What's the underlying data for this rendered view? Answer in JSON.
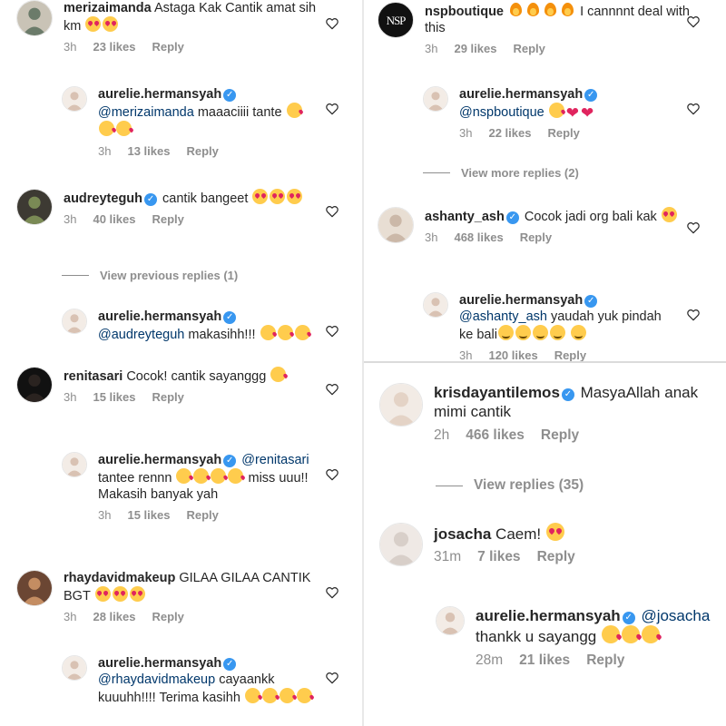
{
  "left": [
    {
      "id": "c1",
      "user": "merizaimanda",
      "verified": false,
      "mention": "",
      "text": "Astaga Kak Cantik amat sih km",
      "emojis": [
        "eyes",
        "eyes"
      ],
      "time": "3h",
      "likes": "23 likes",
      "reply": "Reply"
    },
    {
      "id": "r1",
      "user": "aurelie.hermansyah",
      "verified": true,
      "mention": "@merizaimanda",
      "text": "maaaciiii tante",
      "emojis": [
        "kiss",
        "kiss",
        "kiss"
      ],
      "time": "3h",
      "likes": "13 likes",
      "reply": "Reply"
    },
    {
      "id": "c2",
      "user": "audreyteguh",
      "verified": true,
      "mention": "",
      "text": "cantik bangeet",
      "emojis": [
        "eyes",
        "eyes",
        "eyes"
      ],
      "time": "3h",
      "likes": "40 likes",
      "reply": "Reply"
    },
    {
      "id": "r2",
      "user": "aurelie.hermansyah",
      "verified": true,
      "mention": "@audreyteguh",
      "text": "makasihh!!!",
      "emojis": [
        "kiss",
        "kiss",
        "kiss"
      ],
      "time": "",
      "likes": "",
      "reply": ""
    },
    {
      "id": "c3",
      "user": "renitasari",
      "verified": false,
      "mention": "",
      "text": "Cocok! cantik sayanggg",
      "emojis": [
        "kiss"
      ],
      "time": "3h",
      "likes": "15 likes",
      "reply": "Reply"
    },
    {
      "id": "r3",
      "user": "aurelie.hermansyah",
      "verified": true,
      "mention": "@renitasari",
      "text": "tantee rennn",
      "text2": "miss uuu!! Makasih banyak yah",
      "emojis": [
        "kiss",
        "kiss",
        "kiss",
        "kiss"
      ],
      "time": "3h",
      "likes": "15 likes",
      "reply": "Reply"
    },
    {
      "id": "c4",
      "user": "rhaydavidmakeup",
      "verified": false,
      "mention": "",
      "text": "GILAA GILAA CANTIK BGT",
      "emojis": [
        "eyes",
        "eyes",
        "eyes"
      ],
      "time": "3h",
      "likes": "28 likes",
      "reply": "Reply"
    },
    {
      "id": "r4",
      "user": "aurelie.hermansyah",
      "verified": true,
      "mention": "@rhaydavidmakeup",
      "text": "cayaankk kuuuhh!!!! Terima kasihh",
      "emojis": [
        "kiss",
        "kiss",
        "kiss",
        "kiss"
      ],
      "time": "",
      "likes": "",
      "reply": ""
    }
  ],
  "left_view_previous": "View previous replies (1)",
  "right_top": [
    {
      "id": "c5",
      "user": "nspboutique",
      "verified": false,
      "mention": "",
      "text": "I cannnnt deal with this",
      "emojis_before": [
        "fire",
        "fire",
        "fire",
        "fire"
      ],
      "emojis": [],
      "time": "3h",
      "likes": "29 likes",
      "reply": "Reply"
    },
    {
      "id": "r5",
      "user": "aurelie.hermansyah",
      "verified": true,
      "mention": "@nspboutique",
      "text": "",
      "emojis": [
        "kiss",
        "heart-red",
        "heart-red"
      ],
      "time": "3h",
      "likes": "22 likes",
      "reply": "Reply"
    },
    {
      "id": "c6",
      "user": "ashanty_ash",
      "verified": true,
      "mention": "",
      "text": "Cocok jadi org bali kak",
      "emojis": [
        "eyes"
      ],
      "time": "3h",
      "likes": "468 likes",
      "reply": "Reply"
    },
    {
      "id": "r6",
      "user": "aurelie.hermansyah",
      "verified": true,
      "mention": "@ashanty_ash",
      "text": "yaudah yuk pindah ke bali",
      "emojis_mid": [
        "smile",
        "smile",
        "smile",
        "smile"
      ],
      "emojis": [
        "smile"
      ],
      "time": "3h",
      "likes": "120 likes",
      "reply": "Reply"
    }
  ],
  "right_top_view_more": "View more replies (2)",
  "right_bottom": [
    {
      "id": "c7",
      "user": "krisdayantilemos",
      "verified": true,
      "mention": "",
      "text": "MasyaAllah anak mimi cantik",
      "emojis": [],
      "time": "2h",
      "likes": "466 likes",
      "reply": "Reply"
    },
    {
      "id": "c8",
      "user": "josacha",
      "verified": false,
      "mention": "",
      "text": "Caem!",
      "emojis": [
        "eyes"
      ],
      "time": "31m",
      "likes": "7 likes",
      "reply": "Reply"
    },
    {
      "id": "r8",
      "user": "aurelie.hermansyah",
      "verified": true,
      "mention": "@josacha",
      "text": "thankk u sayangg",
      "emojis": [
        "kiss",
        "kiss",
        "kiss"
      ],
      "time": "28m",
      "likes": "21 likes",
      "reply": "Reply"
    }
  ],
  "right_bottom_view_replies": "View replies (35)",
  "nsp_logo_text": "NSP",
  "colors": {
    "link": "#00376b",
    "meta": "#8e8e8e",
    "verified": "#3897f0",
    "heart": "#e0245e"
  }
}
